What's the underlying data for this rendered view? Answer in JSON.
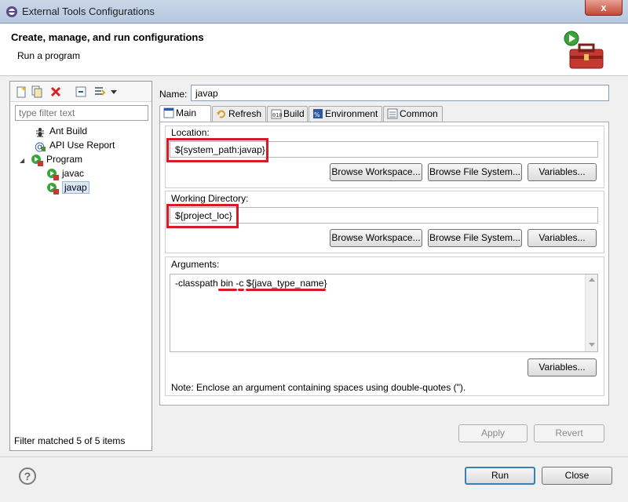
{
  "window": {
    "title": "External Tools Configurations",
    "close_glyph": "x"
  },
  "banner": {
    "heading": "Create, manage, and run configurations",
    "subtitle": "Run a program"
  },
  "left": {
    "filter_placeholder": "type filter text",
    "tree": [
      {
        "label": "Ant Build",
        "icon": "ant-icon"
      },
      {
        "label": "API Use Report",
        "icon": "api-report-icon"
      },
      {
        "label": "Program",
        "icon": "program-icon",
        "expander": "◢"
      },
      {
        "label": "javac",
        "icon": "program-launch-icon"
      },
      {
        "label": "javap",
        "icon": "program-launch-icon",
        "selected": true
      }
    ],
    "status": "Filter matched 5 of 5 items"
  },
  "name": {
    "label": "Name:",
    "value": "javap"
  },
  "tabs": [
    "Main",
    "Refresh",
    "Build",
    "Environment",
    "Common"
  ],
  "main": {
    "location_label": "Location:",
    "location_value": "${system_path:javap}",
    "workdir_label": "Working Directory:",
    "workdir_value": "${project_loc}",
    "arguments_label": "Arguments:",
    "arguments_value": "-classpath bin -c ${java_type_name}",
    "browse_workspace": "Browse Workspace...",
    "browse_filesystem": "Browse File System...",
    "variables": "Variables...",
    "note": "Note: Enclose an argument containing spaces using double-quotes (\")."
  },
  "buttons": {
    "apply": "Apply",
    "revert": "Revert",
    "run": "Run",
    "close": "Close"
  },
  "help_glyph": "?",
  "colors": {
    "highlight": "#d61a27",
    "selection": "#dce8f5"
  }
}
